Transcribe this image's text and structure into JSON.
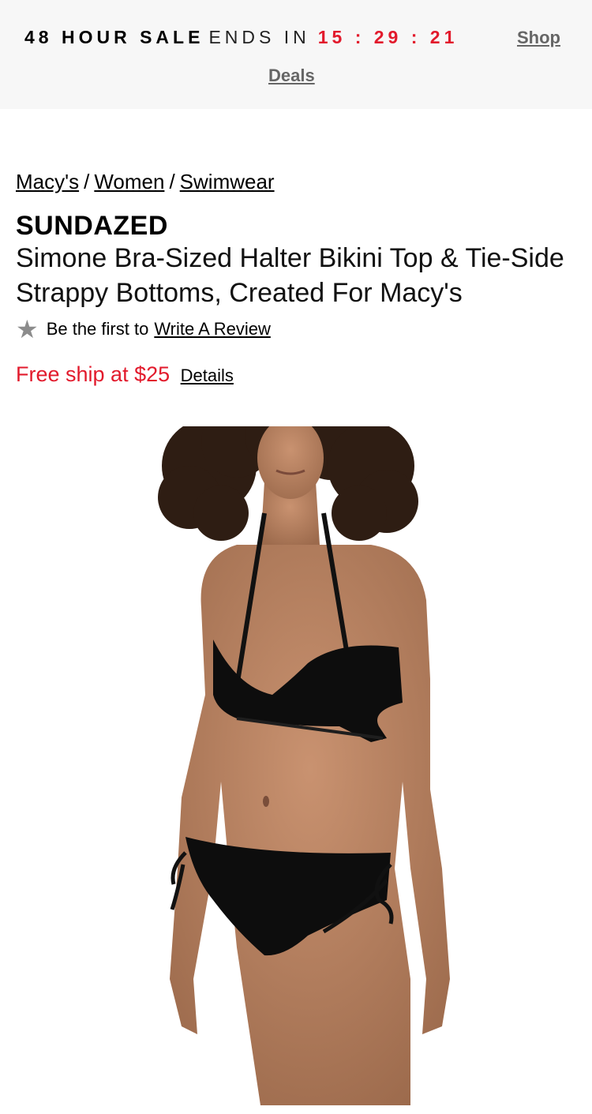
{
  "promo": {
    "sale_label": "48 HOUR SALE",
    "ends_label": "ENDS IN",
    "timer": "15 : 29 : 21",
    "shop_link_line1": "Shop",
    "shop_link_line2": "Deals",
    "timer_color": "#e21a2c"
  },
  "breadcrumb": {
    "items": [
      "Macy's",
      "Women",
      "Swimwear"
    ],
    "separator": "/"
  },
  "product": {
    "brand": "SUNDAZED",
    "title": "Simone Bra-Sized Halter Bikini Top & Tie-Side Strappy Bottoms, Created For Macy's",
    "review_prompt": "Be the first to",
    "review_link": "Write A Review",
    "shipping_text": "Free ship at $25",
    "details_link": "Details",
    "image_icon": "product-photo-icon"
  },
  "colors": {
    "accent_red": "#e21a2c",
    "star_gray": "#8c8c8c",
    "promo_bg": "#f7f7f7"
  }
}
